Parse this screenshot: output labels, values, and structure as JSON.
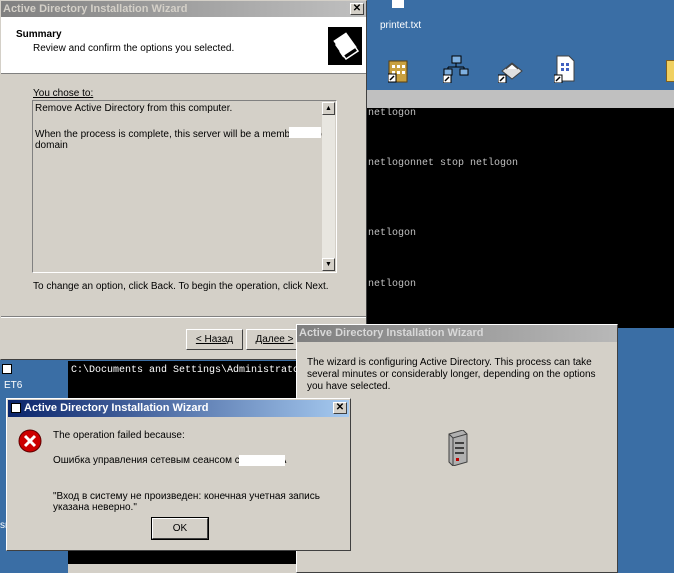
{
  "desktop": {
    "file_label": "printet.txt",
    "left_labels": [
      "ET6",
      "sr"
    ]
  },
  "console_top": {
    "lines": [
      "netlogon",
      "netlogonnet stop netlogon",
      "netlogon",
      "netlogon"
    ]
  },
  "console_bottom": {
    "path": "C:\\Documents and Settings\\Administrato"
  },
  "wizard": {
    "title": "Active Directory Installation Wizard",
    "heading": "Summary",
    "subheading": "Review and confirm the options you selected.",
    "you_chose": "You chose to:",
    "summary_lines": [
      "Remove Active Directory from this computer.",
      "When the process is complete, this server will be a member of the domain"
    ],
    "instruction": "To change an option, click Back. To begin the operation, click Next.",
    "back_label": "< Назад",
    "next_label": "Далее >",
    "close_glyph": "✕"
  },
  "progress_dialog": {
    "title": "Active Directory Installation Wizard",
    "message": "The wizard is configuring Active Directory. This process can take several minutes or considerably longer, depending on the options you have selected."
  },
  "error_dialog": {
    "title": "Active Directory Installation Wizard",
    "line1": "The operation failed because:",
    "line2": "Ошибка управления сетевым сеансом с win2012A",
    "line3": "\"Вход в систему не произведен: конечная учетная запись указана неверно.\"",
    "ok_label": "OK",
    "close_glyph": "✕"
  },
  "colors": {
    "desktop": "#3a6ea5",
    "title_active": "#0a246a",
    "title_inactive": "#808080",
    "error_icon": "#cc0000"
  }
}
